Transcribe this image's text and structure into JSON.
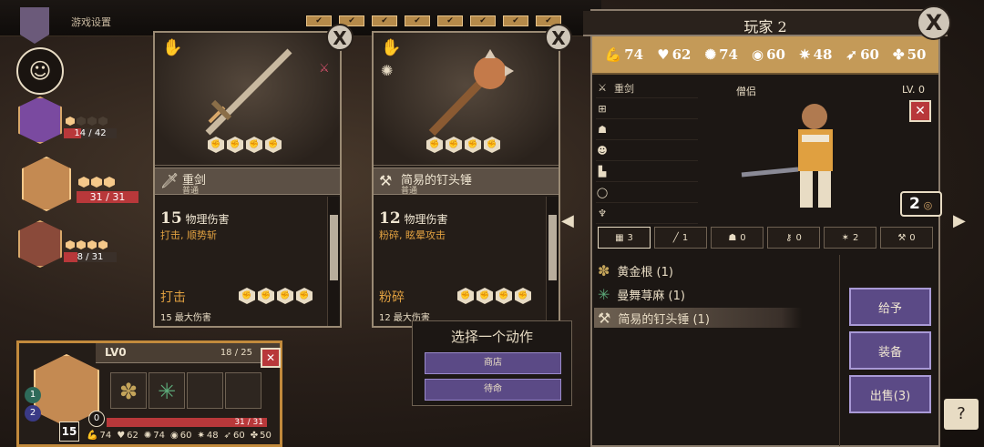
{
  "top_bar": {
    "settings_label": "游戏设置",
    "checks": [
      "✔",
      "✔",
      "✔",
      "✔",
      "✔",
      "✔",
      "✔",
      "✔"
    ]
  },
  "party": {
    "members": [
      {
        "hp": "14 / 42",
        "pips_filled": 1,
        "pips_total": 4
      },
      {
        "hp": "31 / 31",
        "pips_filled": 3,
        "pips_total": 3
      },
      {
        "hp": "8 / 31",
        "pips_filled": 4,
        "pips_total": 4
      }
    ]
  },
  "cards": [
    {
      "name": "重剑",
      "rarity": "普通",
      "damage_value": "15",
      "damage_type": "物理伤害",
      "tags": "打击, 顺势斩",
      "attack_name": "打击",
      "attack_sub": "15 最大伤害",
      "close": "X"
    },
    {
      "name": "简易的钉头锤",
      "rarity": "普通",
      "damage_value": "12",
      "damage_type": "物理伤害",
      "tags": "粉碎, 眩晕攻击",
      "attack_name": "粉碎",
      "attack_sub": "12 最大伤害",
      "close": "X"
    }
  ],
  "action_panel": {
    "title": "选择一个动作",
    "buttons": [
      "商店",
      "待命"
    ]
  },
  "character": {
    "title": "玩家 2",
    "close": "X",
    "stats": [
      {
        "icon": "strength-icon",
        "glyph": "💪",
        "value": "74"
      },
      {
        "icon": "heart-icon",
        "glyph": "♥",
        "value": "62"
      },
      {
        "icon": "brain-icon",
        "glyph": "✺",
        "value": "74"
      },
      {
        "icon": "eye-icon",
        "glyph": "◉",
        "value": "60"
      },
      {
        "icon": "spirit-icon",
        "glyph": "✷",
        "value": "48"
      },
      {
        "icon": "speed-icon",
        "glyph": "➶",
        "value": "60"
      },
      {
        "icon": "luck-icon",
        "glyph": "✤",
        "value": "50"
      }
    ],
    "class_name": "僧侣",
    "level": "LV. 0",
    "gold": "2",
    "slots": [
      {
        "icon": "weapon-slot-icon",
        "glyph": "⚔",
        "label": "重剑"
      },
      {
        "icon": "armor-slot-icon",
        "glyph": "⊞",
        "label": ""
      },
      {
        "icon": "helmet-slot-icon",
        "glyph": "☗",
        "label": ""
      },
      {
        "icon": "head-slot-icon",
        "glyph": "☻",
        "label": ""
      },
      {
        "icon": "boots-slot-icon",
        "glyph": "▙",
        "label": ""
      },
      {
        "icon": "ring-slot-icon",
        "glyph": "◯",
        "label": ""
      },
      {
        "icon": "amulet-slot-icon",
        "glyph": "♆",
        "label": ""
      }
    ],
    "count_tabs": [
      {
        "glyph": "▦",
        "value": "3"
      },
      {
        "glyph": "╱",
        "value": "1"
      },
      {
        "glyph": "☗",
        "value": "0"
      },
      {
        "glyph": "⚷",
        "value": "0"
      },
      {
        "glyph": "✶",
        "value": "2"
      },
      {
        "glyph": "⚒",
        "value": "0"
      }
    ],
    "inventory": [
      {
        "glyph": "✽",
        "label": "黄金根 (1)",
        "color": "#c4a45a"
      },
      {
        "glyph": "✳",
        "label": "曼舞荨麻 (1)",
        "color": "#5ca878"
      },
      {
        "glyph": "⚒",
        "label": "简易的钉头锤 (1)",
        "color": "#e8dcc4"
      }
    ],
    "buttons": [
      "给予",
      "装备",
      "出售(3)"
    ]
  },
  "bottom_char": {
    "level": "LV0",
    "xp": "18 / 25",
    "hp": "31 / 31",
    "badges": [
      "1",
      "2",
      "0",
      "15"
    ],
    "stats": [
      {
        "glyph": "💪",
        "value": "74"
      },
      {
        "glyph": "♥",
        "value": "62"
      },
      {
        "glyph": "✺",
        "value": "74"
      },
      {
        "glyph": "◉",
        "value": "60"
      },
      {
        "glyph": "✷",
        "value": "48"
      },
      {
        "glyph": "➶",
        "value": "60"
      },
      {
        "glyph": "✤",
        "value": "50"
      }
    ]
  },
  "colors": {
    "accent_gold": "#c49a58",
    "button_purple": "#5b4a86",
    "hp_red": "#b8383a",
    "warning_orange": "#e0a040"
  }
}
